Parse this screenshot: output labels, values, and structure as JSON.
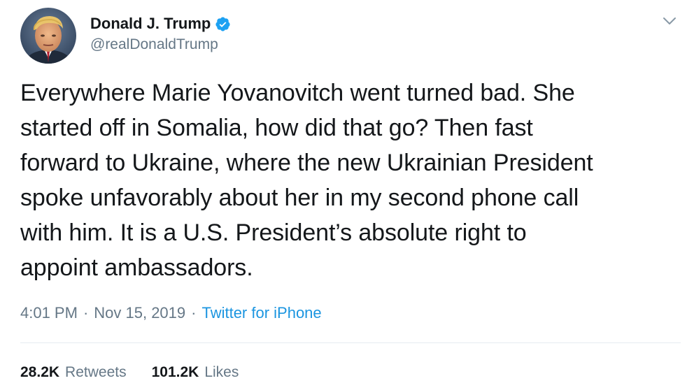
{
  "author": {
    "name": "Donald J. Trump",
    "handle": "@realDonaldTrump",
    "avatar_icon": "profile-photo",
    "verified_icon": "verified-badge-icon"
  },
  "menu": {
    "icon": "chevron-down-icon"
  },
  "tweet": {
    "text": "Everywhere Marie Yovanovitch went turned bad. She\nstarted off in Somalia, how did that go? Then fast\nforward to Ukraine, where the new Ukrainian President\nspoke unfavorably about her in my second phone call\nwith him. It is a U.S. President’s absolute right to\nappoint ambassadors."
  },
  "meta": {
    "time": "4:01 PM",
    "separator": "·",
    "date": "Nov 15, 2019",
    "source": "Twitter for iPhone"
  },
  "stats": {
    "retweets_count": "28.2K",
    "retweets_label": "Retweets",
    "likes_count": "101.2K",
    "likes_label": "Likes"
  },
  "colors": {
    "text": "#14171a",
    "secondary": "#657786",
    "link": "#1b95e0",
    "verified": "#1da1f2",
    "divider": "#e6ecf0"
  }
}
